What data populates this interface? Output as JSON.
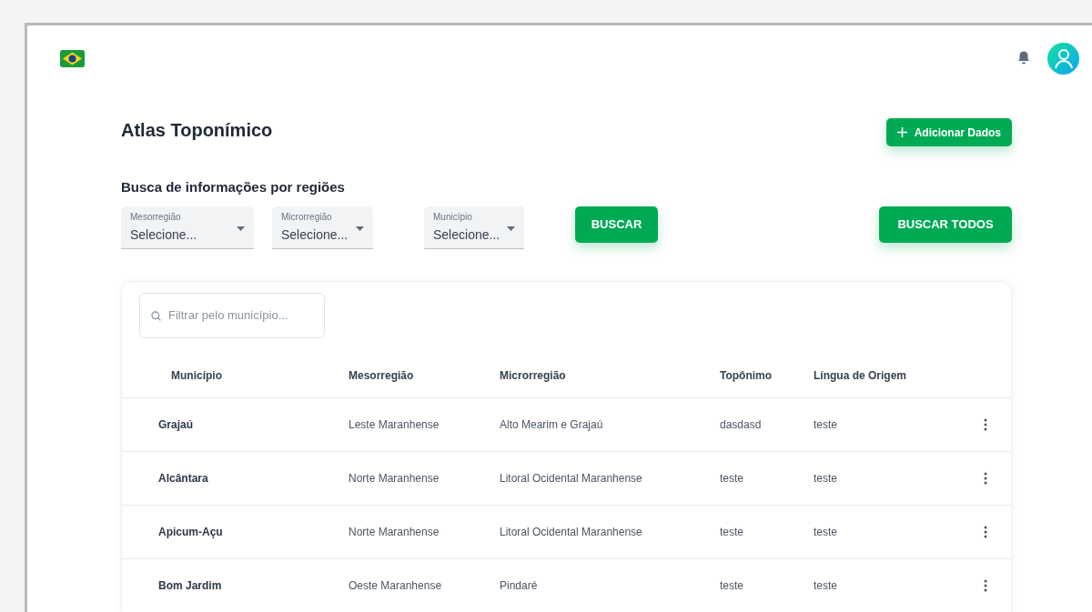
{
  "page": {
    "title": "Atlas Toponímico",
    "add_button": "Adicionar Dados"
  },
  "search_section": {
    "title": "Busca de informações por regiões",
    "selects": [
      {
        "label": "Mesorregião",
        "value": "Selecione..."
      },
      {
        "label": "Microrregião",
        "value": "Selecione..."
      },
      {
        "label": "Município",
        "value": "Selecione..."
      }
    ],
    "search_button": "BUSCAR",
    "search_all_button": "BUSCAR TODOS"
  },
  "table": {
    "filter": {
      "placeholder": "Filtrar pelo município..."
    },
    "columns": [
      "Município",
      "Mesorregião",
      "Microrregião",
      "Topônimo",
      "Língua de Origem"
    ],
    "rows": [
      [
        "Grajaú",
        "Leste Maranhense",
        "Alto Mearim e Grajaú",
        "dasdasd",
        "teste"
      ],
      [
        "Alcântara",
        "Norte Maranhense",
        "Litoral Ocidental Maranhense",
        "teste",
        "teste"
      ],
      [
        "Apicum-Açu",
        "Norte Maranhense",
        "Litoral Ocidental Maranhense",
        "teste",
        "teste"
      ],
      [
        "Bom Jardim",
        "Oeste Maranhense",
        "Pindaré",
        "teste",
        "teste"
      ]
    ]
  }
}
